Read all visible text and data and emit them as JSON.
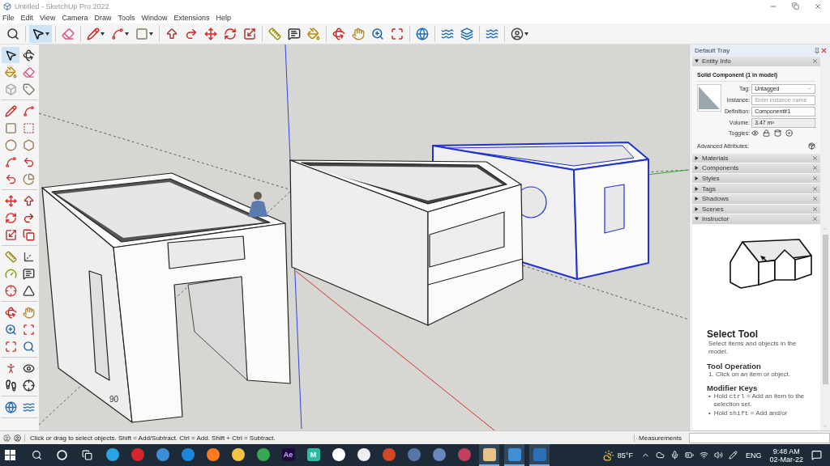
{
  "window": {
    "title": "Untitled - SketchUp Pro 2022"
  },
  "menu": [
    "File",
    "Edit",
    "View",
    "Camera",
    "Draw",
    "Tools",
    "Window",
    "Extensions",
    "Help"
  ],
  "toolbar": {
    "tools": [
      {
        "selected": false
      },
      {
        "selected": true
      },
      {
        "selected": false
      },
      {
        "selected": false
      },
      {
        "selected": false
      },
      {
        "selected": false
      },
      {
        "selected": false
      },
      {
        "selected": false
      },
      {
        "selected": false
      },
      {
        "selected": false
      },
      {
        "selected": false
      },
      {
        "selected": false
      },
      {
        "selected": false
      },
      {
        "selected": false
      },
      {
        "selected": false
      },
      {
        "selected": false
      },
      {
        "selected": false
      },
      {
        "selected": false
      },
      {
        "selected": false
      },
      {
        "selected": false
      },
      {
        "selected": false
      },
      {
        "selected": false
      },
      {
        "selected": false
      }
    ]
  },
  "left_toolbar": {
    "tools": [
      {
        "selected": true
      },
      {
        "selected": false
      },
      {
        "selected": false
      },
      {
        "selected": false
      },
      {
        "selected": false
      },
      {
        "selected": false
      },
      {
        "selected": false
      },
      {
        "selected": false
      },
      {
        "selected": false
      },
      {
        "selected": false
      },
      {
        "selected": false
      },
      {
        "selected": false
      },
      {
        "selected": false
      },
      {
        "selected": false
      },
      {
        "selected": false
      },
      {
        "selected": false
      },
      {
        "selected": false
      },
      {
        "selected": false
      },
      {
        "selected": false
      },
      {
        "selected": false
      },
      {
        "selected": false
      },
      {
        "selected": false
      },
      {
        "selected": false
      },
      {
        "selected": false
      },
      {
        "selected": false
      },
      {
        "selected": false
      },
      {
        "selected": false
      },
      {
        "selected": false
      },
      {
        "selected": false
      },
      {
        "selected": false
      },
      {
        "selected": false
      },
      {
        "selected": false
      },
      {
        "selected": false
      },
      {
        "selected": false
      },
      {
        "selected": false
      },
      {
        "selected": false
      },
      {
        "selected": false
      },
      {
        "selected": false
      },
      {
        "selected": false
      },
      {
        "selected": false
      }
    ]
  },
  "viewport": {
    "label": "90"
  },
  "tray": {
    "title": "Default Tray",
    "entity_info": {
      "title": "Entity Info",
      "expanded": true,
      "heading": "Solid Component (1 in model)",
      "fields": [
        {
          "label": "Tag:",
          "kind": "dropdown",
          "value": "Untagged"
        },
        {
          "label": "Instance:",
          "kind": "text",
          "placeholder": "Enter instance name"
        },
        {
          "label": "Definition:",
          "kind": "text",
          "value": "Component#1"
        },
        {
          "label": "Volume:",
          "kind": "readout",
          "value": "3.47 m³"
        }
      ],
      "toggles_label": "Toggles:",
      "advanced_label": "Advanced Attributes:"
    },
    "panels": [
      {
        "title": "Materials",
        "expanded": false
      },
      {
        "title": "Components",
        "expanded": false
      },
      {
        "title": "Styles",
        "expanded": false
      },
      {
        "title": "Tags",
        "expanded": false
      },
      {
        "title": "Shadows",
        "expanded": false
      },
      {
        "title": "Scenes",
        "expanded": false
      },
      {
        "title": "Instructor",
        "expanded": true
      }
    ],
    "instructor": {
      "title": "Select Tool",
      "intro": "Select items and objects in the model.",
      "sections": [
        {
          "heading": "Tool Operation",
          "items": [
            {
              "kind": "numbered",
              "text": "1. Click on an item or object."
            }
          ]
        },
        {
          "heading": "Modifier Keys",
          "items": [
            {
              "kind": "bullet",
              "marker": "•",
              "before": "Hold",
              "key": "ctrl",
              "after": "= Add an item to the selection set."
            },
            {
              "kind": "bullet",
              "marker": "•",
              "before": "Hold",
              "key": "shift",
              "after": "= Add and/or"
            }
          ]
        }
      ]
    }
  },
  "status_bar": {
    "hint": "Click or drag to select objects. Shift = Add/Subtract. Ctrl = Add. Shift + Ctrl = Subtract.",
    "measurements_label": "Measurements"
  },
  "taskbar": {
    "apps": [
      {
        "color": "#2aa3e0",
        "open": false
      },
      {
        "color": "#d6262c",
        "open": false
      },
      {
        "color": "#3b8fd8",
        "open": false
      },
      {
        "color": "#1e88d8",
        "open": false
      },
      {
        "color": "#ff7a1f",
        "open": false
      },
      {
        "color": "#f5c342",
        "open": false
      },
      {
        "color": "#34a853",
        "open": false
      },
      {
        "color": "#1f0a3d",
        "label": "Ae",
        "open": false
      },
      {
        "color": "#2fb9a0",
        "label": "M",
        "open": false
      },
      {
        "color": "#ffffff",
        "open": false
      },
      {
        "color": "#eeeeee",
        "open": false
      },
      {
        "color": "#d24726",
        "open": false
      },
      {
        "color": "#5577aa",
        "open": false
      },
      {
        "color": "#6688bb",
        "open": false
      },
      {
        "color": "#c04060",
        "open": false
      },
      {
        "color": "#e8c48a",
        "open": true
      },
      {
        "color": "#3d8fd6",
        "open": true
      },
      {
        "color": "#2b6fb8",
        "open": true
      }
    ],
    "weather": "85°F",
    "language": "ENG",
    "time": "9:48 AM",
    "date": "02-Mar-22"
  }
}
